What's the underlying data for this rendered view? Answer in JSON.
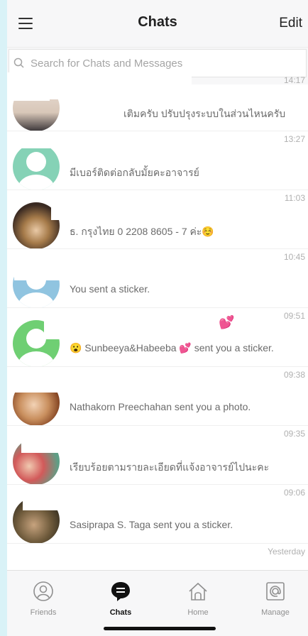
{
  "header": {
    "title": "Chats",
    "edit_label": "Edit",
    "menu_icon": "menu-icon"
  },
  "search": {
    "placeholder": "Search for Chats and Messages"
  },
  "chats": [
    {
      "time": "14:17",
      "message": "เติมครับ ปรับปรุงระบบในส่วนไหนครับ"
    },
    {
      "time": "13:27",
      "message": "มีเบอร์ติดต่อกลับมั้ยคะอาจารย์"
    },
    {
      "time": "11:03",
      "message": "ธ. กรุงไทย 0 2208 8605 - 7 ค่ะ☺️"
    },
    {
      "time": "10:45",
      "message": "You sent a sticker."
    },
    {
      "time": "09:51",
      "message": "😮 Sunbeeya&Habeeba 💕 sent you a sticker."
    },
    {
      "time": "09:38",
      "message": "Nathakorn Preechahan sent you a photo."
    },
    {
      "time": "09:35",
      "message": "เรียบร้อยตามรายละเอียดที่แจ้งอาจารย์ไปนะคะ"
    },
    {
      "time": "09:06",
      "message": "Sasiprapa S. Taga sent you a sticker."
    },
    {
      "time": "Yesterday",
      "message": ""
    }
  ],
  "tabs": [
    {
      "label": "Friends",
      "icon": "friends-icon",
      "active": false
    },
    {
      "label": "Chats",
      "icon": "chat-bubble-icon",
      "active": true
    },
    {
      "label": "Home",
      "icon": "home-icon",
      "active": false
    },
    {
      "label": "Manage",
      "icon": "at-sign-icon",
      "active": false
    }
  ],
  "colors": {
    "accent": "#111111",
    "inactive": "#8f8f8f",
    "background": "#d9f2f7"
  }
}
